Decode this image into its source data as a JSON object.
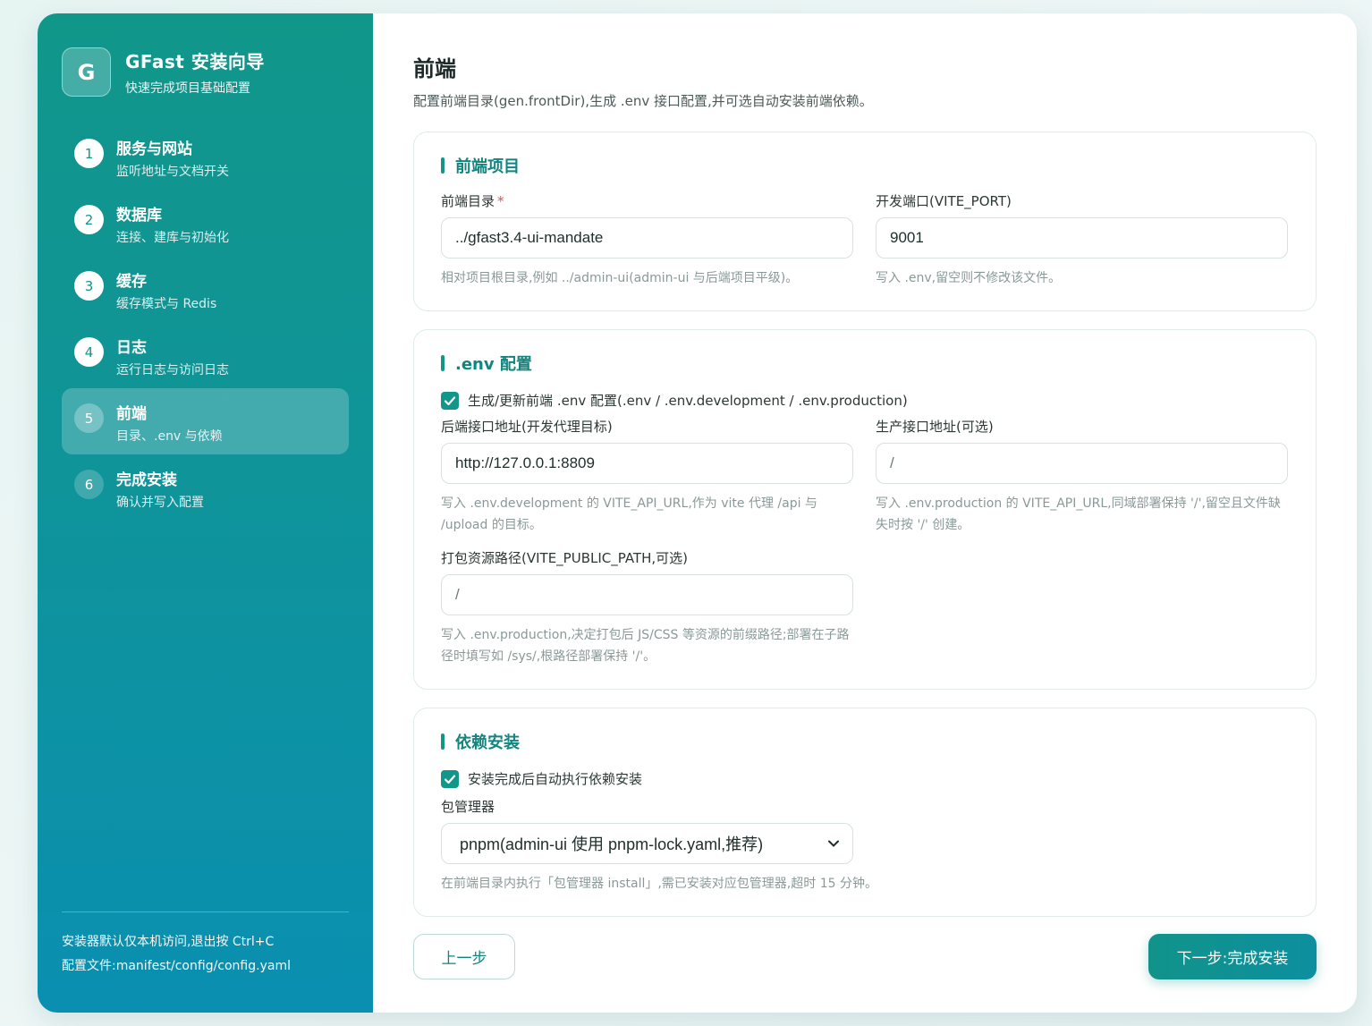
{
  "brand": {
    "logo": "G",
    "title": "GFast 安装向导",
    "subtitle": "快速完成项目基础配置"
  },
  "steps": [
    {
      "num": "1",
      "title": "服务与网站",
      "sub": "监听地址与文档开关",
      "state": "done"
    },
    {
      "num": "2",
      "title": "数据库",
      "sub": "连接、建库与初始化",
      "state": "done"
    },
    {
      "num": "3",
      "title": "缓存",
      "sub": "缓存模式与 Redis",
      "state": "done"
    },
    {
      "num": "4",
      "title": "日志",
      "sub": "运行日志与访问日志",
      "state": "done"
    },
    {
      "num": "5",
      "title": "前端",
      "sub": "目录、.env 与依赖",
      "state": "active"
    },
    {
      "num": "6",
      "title": "完成安装",
      "sub": "确认并写入配置",
      "state": "pending"
    }
  ],
  "sidebar_footer": {
    "line1": "安装器默认仅本机访问,退出按 Ctrl+C",
    "line2": "配置文件:manifest/config/config.yaml"
  },
  "page": {
    "title": "前端",
    "desc": "配置前端目录(gen.frontDir),生成 .env 接口配置,并可选自动安装前端依赖。"
  },
  "frontend_card": {
    "title": "前端项目",
    "dir_label": "前端目录",
    "dir_value": "../gfast3.4-ui-mandate",
    "dir_hint": "相对项目根目录,例如 ../admin-ui(admin-ui 与后端项目平级)。",
    "port_label": "开发端口(VITE_PORT)",
    "port_value": "9001",
    "port_hint": "写入 .env,留空则不修改该文件。"
  },
  "env_card": {
    "title": ".env 配置",
    "check_label": "生成/更新前端 .env 配置(.env / .env.development / .env.production)",
    "api_label": "后端接口地址(开发代理目标)",
    "api_value": "http://127.0.0.1:8809",
    "api_hint": "写入 .env.development 的 VITE_API_URL,作为 vite 代理 /api 与 /upload 的目标。",
    "prod_label": "生产接口地址(可选)",
    "prod_value": "/",
    "prod_hint": "写入 .env.production 的 VITE_API_URL,同域部署保持 '/',留空且文件缺失时按 '/' 创建。",
    "public_label": "打包资源路径(VITE_PUBLIC_PATH,可选)",
    "public_value": "/",
    "public_hint": "写入 .env.production,决定打包后 JS/CSS 等资源的前缀路径;部署在子路径时填写如 /sys/,根路径部署保持 '/'。"
  },
  "deps_card": {
    "title": "依赖安装",
    "check_label": "安装完成后自动执行依赖安装",
    "pm_label": "包管理器",
    "pm_value": "pnpm(admin-ui 使用 pnpm-lock.yaml,推荐)",
    "pm_hint": "在前端目录内执行「包管理器 install」,需已安装对应包管理器,超时 15 分钟。"
  },
  "actions": {
    "prev": "上一步",
    "next": "下一步:完成安装"
  },
  "colors": {
    "accent": "#12968a",
    "sidebar_top": "#11968a",
    "sidebar_bottom": "#0a8fb1"
  }
}
